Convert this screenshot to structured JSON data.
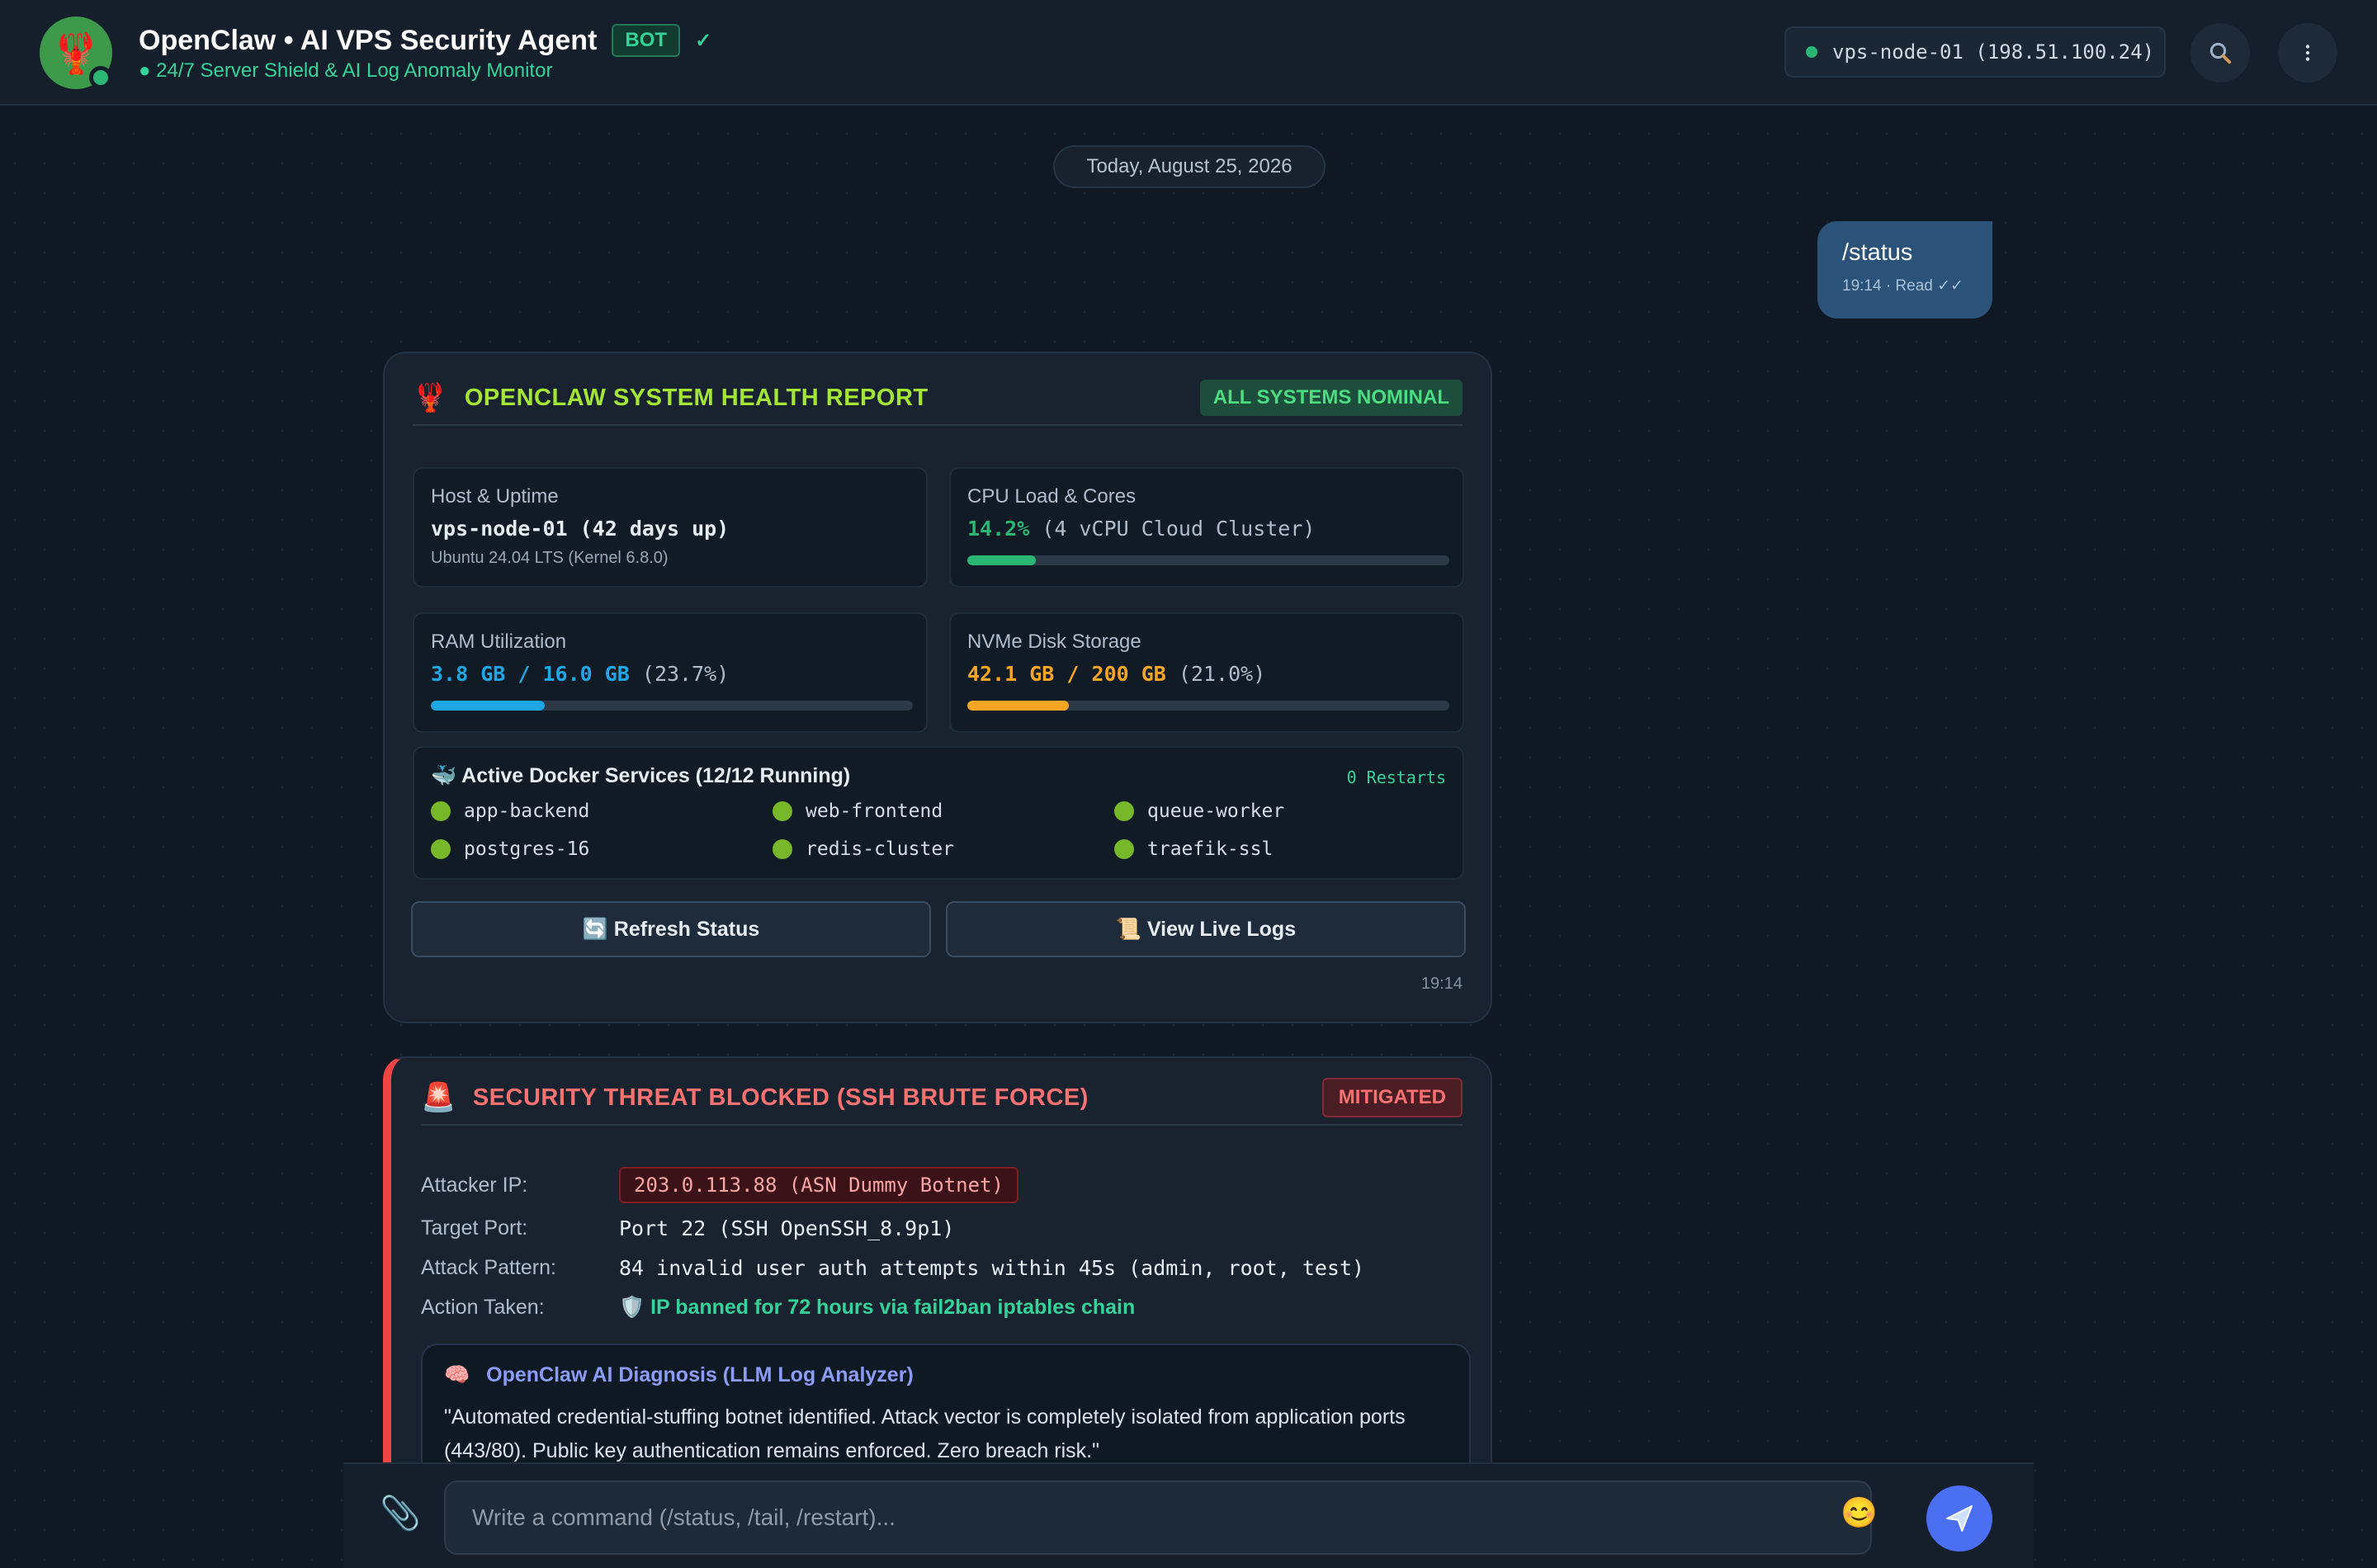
{
  "header": {
    "avatar_icon": "lobster-icon",
    "title": "OpenClaw • AI VPS Security Agent",
    "badge": "BOT",
    "verified": "✓",
    "subtitle": "● 24/7 Server Shield & AI Log Anomaly Monitor",
    "server": "vps-node-01 (198.51.100.24)",
    "search_icon": "search-icon",
    "menu_icon": "more-vertical-icon"
  },
  "date_divider": "Today, August 25, 2026",
  "user_message": {
    "text": "/status",
    "meta": "19:14 · Read ✓✓"
  },
  "health_report": {
    "emoji": "🦞",
    "title": "OPENCLAW SYSTEM HEALTH REPORT",
    "status_badge": "ALL SYSTEMS NOMINAL",
    "host": {
      "label": "Host & Uptime",
      "value": "vps-node-01 (42 days up)",
      "sub": "Ubuntu 24.04 LTS (Kernel 6.8.0)"
    },
    "cpu": {
      "label": "CPU Load & Cores",
      "value": "14.2%",
      "detail": "(4 vCPU Cloud Cluster)",
      "percent": 14.2,
      "color": "#2bb673"
    },
    "ram": {
      "label": "RAM Utilization",
      "value": "3.8 GB / 16.0 GB",
      "detail": "(23.7%)",
      "percent": 23.7,
      "color": "#1ea7e4"
    },
    "disk": {
      "label": "NVMe Disk Storage",
      "value": "42.1 GB / 200 GB",
      "detail": "(21.0%)",
      "percent": 21.0,
      "color": "#f5a524"
    },
    "docker": {
      "emoji": "🐳",
      "title": "Active Docker Services (12/12 Running)",
      "restarts": "0 Restarts",
      "services": [
        "app-backend",
        "web-frontend",
        "queue-worker",
        "postgres-16",
        "redis-cluster",
        "traefik-ssl"
      ]
    },
    "buttons": {
      "refresh": "🔄 Refresh Status",
      "logs": "📜 View Live Logs"
    },
    "time": "19:14"
  },
  "threat": {
    "emoji": "🚨",
    "title": "SECURITY THREAT BLOCKED (SSH BRUTE FORCE)",
    "status_badge": "MITIGATED",
    "attacker_ip_label": "Attacker IP:",
    "attacker_ip": "203.0.113.88 (ASN Dummy Botnet)",
    "target_port_label": "Target Port:",
    "target_port": "Port 22 (SSH OpenSSH_8.9p1)",
    "pattern_label": "Attack Pattern:",
    "pattern": "84 invalid user auth attempts within 45s (admin, root, test)",
    "action_label": "Action Taken:",
    "action": "🛡️ IP banned for 72 hours via fail2ban iptables chain",
    "diagnosis": {
      "emoji": "🧠",
      "title": "OpenClaw AI Diagnosis (LLM Log Analyzer)",
      "text": "\"Automated credential-stuffing botnet identified. Attack vector is completely isolated from application ports (443/80). Public key authentication remains enforced. Zero breach risk.\""
    }
  },
  "composer": {
    "attach_icon": "paperclip-icon",
    "placeholder": "Write a command (/status, /tail, /restart)...",
    "emoji": "😊",
    "send_icon": "send-icon"
  }
}
